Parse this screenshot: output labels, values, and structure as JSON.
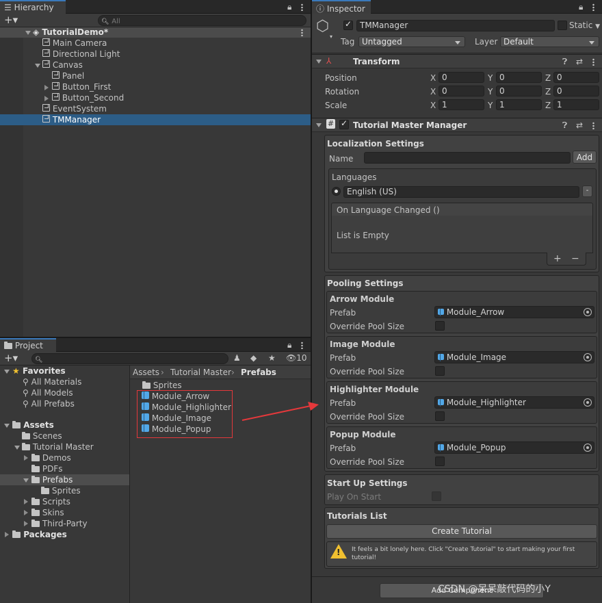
{
  "hierarchy": {
    "tab": "Hierarchy",
    "search_placeholder": "All",
    "scene": "TutorialDemo*",
    "items": [
      "Main Camera",
      "Directional Light",
      "Canvas",
      "Panel",
      "Button_First",
      "Button_Second",
      "EventSystem",
      "TMManager"
    ]
  },
  "project": {
    "tab": "Project",
    "badge_count": "10",
    "favorites": {
      "label": "Favorites",
      "items": [
        "All Materials",
        "All Models",
        "All Prefabs"
      ]
    },
    "assets": {
      "label": "Assets",
      "items": [
        "Scenes",
        "Tutorial Master",
        "Demos",
        "PDFs",
        "Prefabs",
        "Sprites",
        "Scripts",
        "Skins",
        "Third-Party"
      ]
    },
    "packages": "Packages",
    "breadcrumb": [
      "Assets",
      "Tutorial Master",
      "Prefabs"
    ],
    "files": [
      "Sprites",
      "Module_Arrow",
      "Module_Highlighter",
      "Module_Image",
      "Module_Popup"
    ]
  },
  "inspector": {
    "tab": "Inspector",
    "object_name": "TMManager",
    "static_label": "Static",
    "tag_label": "Tag",
    "tag_value": "Untagged",
    "layer_label": "Layer",
    "layer_value": "Default",
    "transform": {
      "title": "Transform",
      "rows": [
        {
          "label": "Position",
          "x": "0",
          "y": "0",
          "z": "0"
        },
        {
          "label": "Rotation",
          "x": "0",
          "y": "0",
          "z": "0"
        },
        {
          "label": "Scale",
          "x": "1",
          "y": "1",
          "z": "1"
        }
      ],
      "axes": [
        "X",
        "Y",
        "Z"
      ]
    },
    "component": {
      "title": "Tutorial Master Manager",
      "localization": {
        "title": "Localization Settings",
        "name_label": "Name",
        "add_button": "Add",
        "languages_label": "Languages",
        "language_value": "English (US)",
        "remove_button": "-",
        "event_title": "On Language Changed ()",
        "empty_text": "List is Empty",
        "plus": "+",
        "minus": "−"
      },
      "pooling": {
        "title": "Pooling Settings",
        "prefab_label": "Prefab",
        "override_label": "Override Pool Size",
        "modules": [
          {
            "title": "Arrow Module",
            "prefab": "Module_Arrow"
          },
          {
            "title": "Image Module",
            "prefab": "Module_Image"
          },
          {
            "title": "Highlighter Module",
            "prefab": "Module_Highlighter"
          },
          {
            "title": "Popup Module",
            "prefab": "Module_Popup"
          }
        ]
      },
      "startup": {
        "title": "Start Up Settings",
        "play_label": "Play On Start"
      },
      "tutorials": {
        "title": "Tutorials List",
        "create_button": "Create Tutorial",
        "warning": "It feels a bit lonely here. Click \"Create Tutorial\" to start making your first tutorial!"
      }
    },
    "add_component": "Add Component"
  },
  "watermark": "CSDN @呆呆敲代码的小Y",
  "colors": {
    "accent": "#3a79bb",
    "selection": "#2c5d87",
    "annotation": "#e5383b"
  }
}
